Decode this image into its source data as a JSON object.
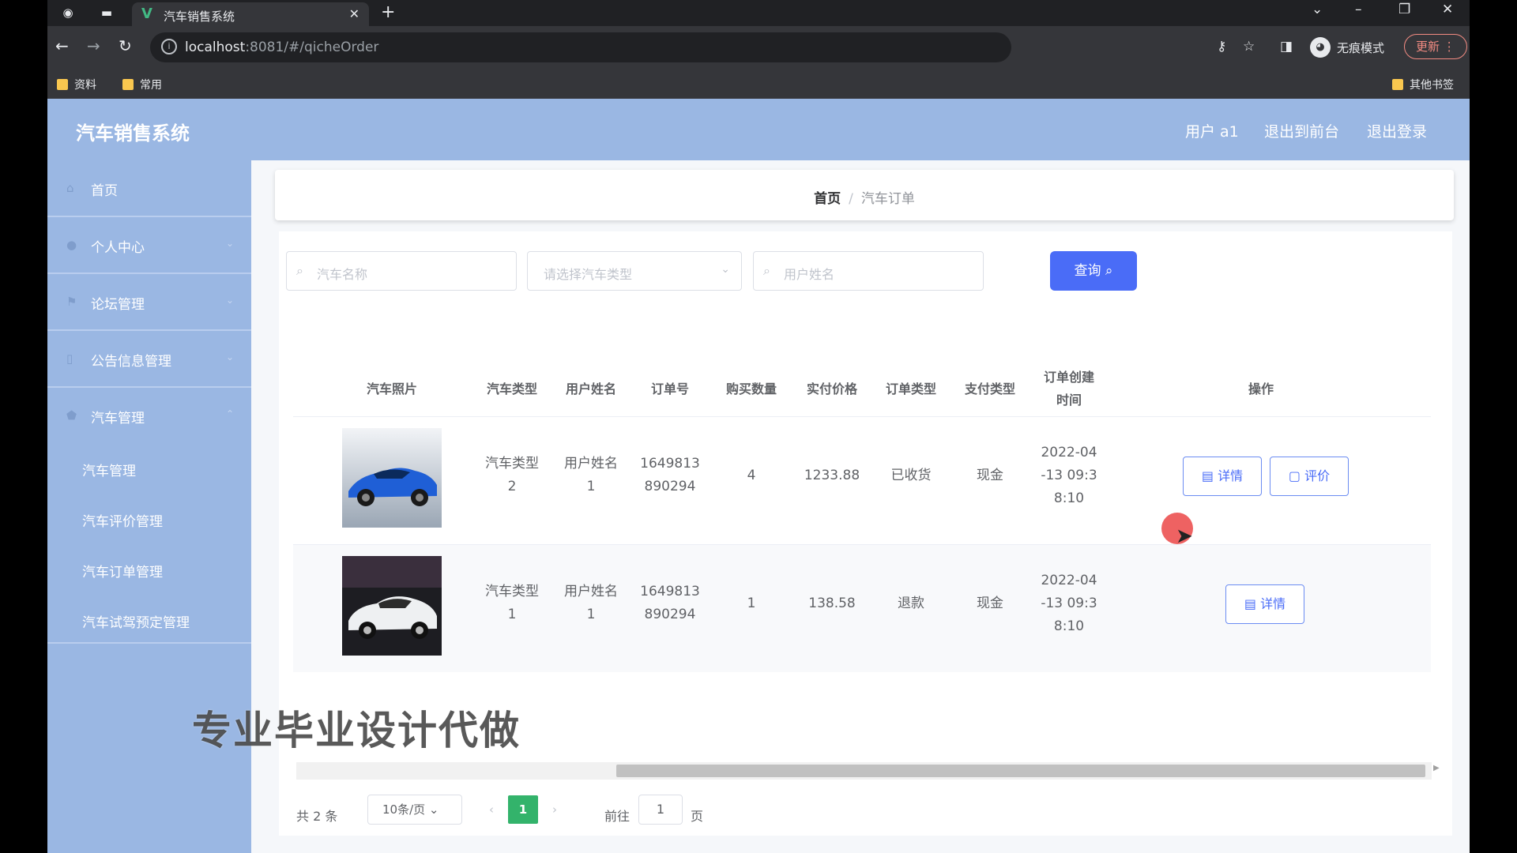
{
  "browser": {
    "tab_title": "汽车销售系统",
    "url_host": "localhost",
    "url_rest": ":8081/#/qicheOrder",
    "incognito_label": "无痕模式",
    "update_label": "更新",
    "bookmarks": [
      "资料",
      "常用"
    ],
    "other_bookmarks": "其他书签"
  },
  "header": {
    "title": "汽车销售系统",
    "user": "用户 a1",
    "to_front": "退出到前台",
    "logout": "退出登录"
  },
  "sidebar": {
    "items": [
      {
        "label": "首页",
        "icon": "home-icon"
      },
      {
        "label": "个人中心",
        "icon": "user-icon"
      },
      {
        "label": "论坛管理",
        "icon": "flag-icon"
      },
      {
        "label": "公告信息管理",
        "icon": "doc-icon"
      },
      {
        "label": "汽车管理",
        "icon": "shield-icon"
      }
    ],
    "sub_items": [
      "汽车管理",
      "汽车评价管理",
      "汽车订单管理",
      "汽车试驾预定管理"
    ]
  },
  "breadcrumb": {
    "home": "首页",
    "separator": "/",
    "current": "汽车订单"
  },
  "search": {
    "car_name_placeholder": "汽车名称",
    "car_type_placeholder": "请选择汽车类型",
    "user_name_placeholder": "用户姓名",
    "query_label": "查询"
  },
  "table": {
    "headers": [
      "汽车照片",
      "汽车类型",
      "用户姓名",
      "订单号",
      "购买数量",
      "实付价格",
      "订单类型",
      "支付类型",
      "订单创建时间",
      "操作"
    ],
    "header_wrapped": {
      "created": [
        "订单创建",
        "时间"
      ]
    },
    "rows": [
      {
        "car_type": [
          "汽车类型",
          "2"
        ],
        "user_name": [
          "用户姓名",
          "1"
        ],
        "order_no": [
          "1649813",
          "890294"
        ],
        "quantity": "4",
        "price": "1233.88",
        "order_type": "已收货",
        "pay_type": "现金",
        "created": [
          "2022-04",
          "-13 09:3",
          "8:10"
        ],
        "actions": [
          "详情",
          "评价"
        ],
        "photo": "blue-sports-car"
      },
      {
        "car_type": [
          "汽车类型",
          "1"
        ],
        "user_name": [
          "用户姓名",
          "1"
        ],
        "order_no": [
          "1649813",
          "890294"
        ],
        "quantity": "1",
        "price": "138.58",
        "order_type": "退款",
        "pay_type": "现金",
        "created": [
          "2022-04",
          "-13 09:3",
          "8:10"
        ],
        "actions": [
          "详情"
        ],
        "photo": "white-sedan"
      }
    ]
  },
  "pager": {
    "total": "共 2 条",
    "page_size": "10条/页",
    "current_page": "1",
    "goto_label": "前往",
    "goto_value": "1",
    "page_unit": "页"
  },
  "overlay": {
    "watermark": "专业毕业设计代做"
  },
  "colors": {
    "header_bg": "#9ab7e3",
    "accent": "#4a6cf7",
    "pager_active": "#33b36b"
  }
}
